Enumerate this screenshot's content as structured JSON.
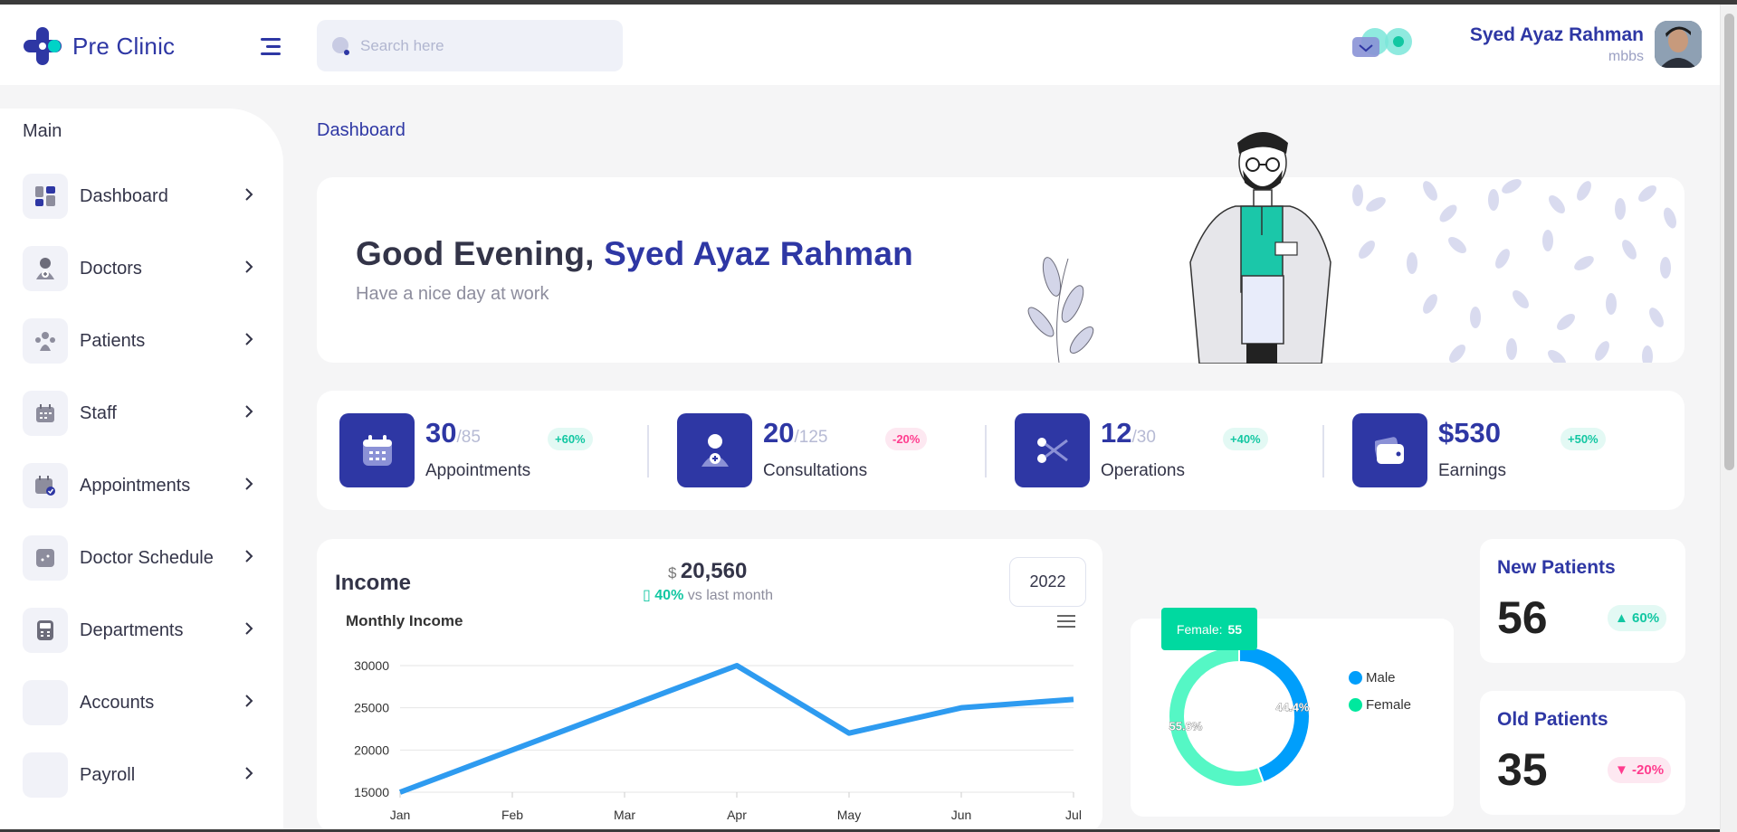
{
  "app": {
    "name": "Pre Clinic"
  },
  "search": {
    "placeholder": "Search here"
  },
  "user": {
    "name": "Syed Ayaz Rahman",
    "role": "mbbs"
  },
  "sidebar": {
    "section_title": "Main",
    "items": [
      {
        "label": "Dashboard",
        "icon": "dashboard-icon"
      },
      {
        "label": "Doctors",
        "icon": "doctor-icon"
      },
      {
        "label": "Patients",
        "icon": "patients-icon"
      },
      {
        "label": "Staff",
        "icon": "calendar-icon"
      },
      {
        "label": "Appointments",
        "icon": "calendar-check-icon"
      },
      {
        "label": "Doctor Schedule",
        "icon": "schedule-icon"
      },
      {
        "label": "Departments",
        "icon": "department-icon"
      },
      {
        "label": "Accounts",
        "icon": "accounts-icon"
      },
      {
        "label": "Payroll",
        "icon": "payroll-icon"
      }
    ]
  },
  "breadcrumb": "Dashboard",
  "hero": {
    "greeting": "Good Evening,",
    "name": "Syed Ayaz Rahman",
    "subtitle": "Have a nice day at work"
  },
  "stats": [
    {
      "value": "30",
      "total": "/85",
      "label": "Appointments",
      "badge": "+60%",
      "trend": "up",
      "icon": "calendar-icon"
    },
    {
      "value": "20",
      "total": "/125",
      "label": "Consultations",
      "badge": "-20%",
      "trend": "down",
      "icon": "doctor-add-icon"
    },
    {
      "value": "12",
      "total": "/30",
      "label": "Operations",
      "badge": "+40%",
      "trend": "up",
      "icon": "scissors-icon"
    },
    {
      "value": "$530",
      "total": "",
      "label": "Earnings",
      "badge": "+50%",
      "trend": "up",
      "icon": "wallet-icon"
    }
  ],
  "income": {
    "title": "Income",
    "currency": "$",
    "amount": "20,560",
    "delta_pct": "40%",
    "delta_text": "vs last month",
    "year": "2022",
    "chart_title": "Monthly Income"
  },
  "chart_data": [
    {
      "type": "line",
      "title": "Monthly Income",
      "categories": [
        "Jan",
        "Feb",
        "Mar",
        "Apr",
        "May",
        "Jun",
        "Jul"
      ],
      "series": [
        {
          "values": [
            15000,
            20000,
            25000,
            30000,
            22000,
            25000,
            26000
          ]
        }
      ],
      "y_ticks": [
        "15000",
        "20000",
        "25000",
        "30000"
      ],
      "ylim": [
        15000,
        30000
      ],
      "grid": true,
      "color": "#2e9bf0"
    },
    {
      "type": "pie",
      "style": "donut",
      "categories": [
        "Male",
        "Female"
      ],
      "values": [
        44.4,
        55.6
      ],
      "labels": [
        "44.4%",
        "55.6%"
      ],
      "colors": [
        "#009efb",
        "#55f7c5"
      ],
      "tooltip": {
        "label": "Female:",
        "value": "55"
      },
      "legend": "right"
    }
  ],
  "new_patients": {
    "title": "New Patients",
    "value": "56",
    "badge": "60%",
    "trend": "up"
  },
  "old_patients": {
    "title": "Old Patients",
    "value": "35",
    "badge": "-20%",
    "trend": "down"
  },
  "colors": {
    "primary": "#2e37a4",
    "accent": "#00d9a0",
    "up": "#12c7a2",
    "down": "#ff3c8e"
  }
}
